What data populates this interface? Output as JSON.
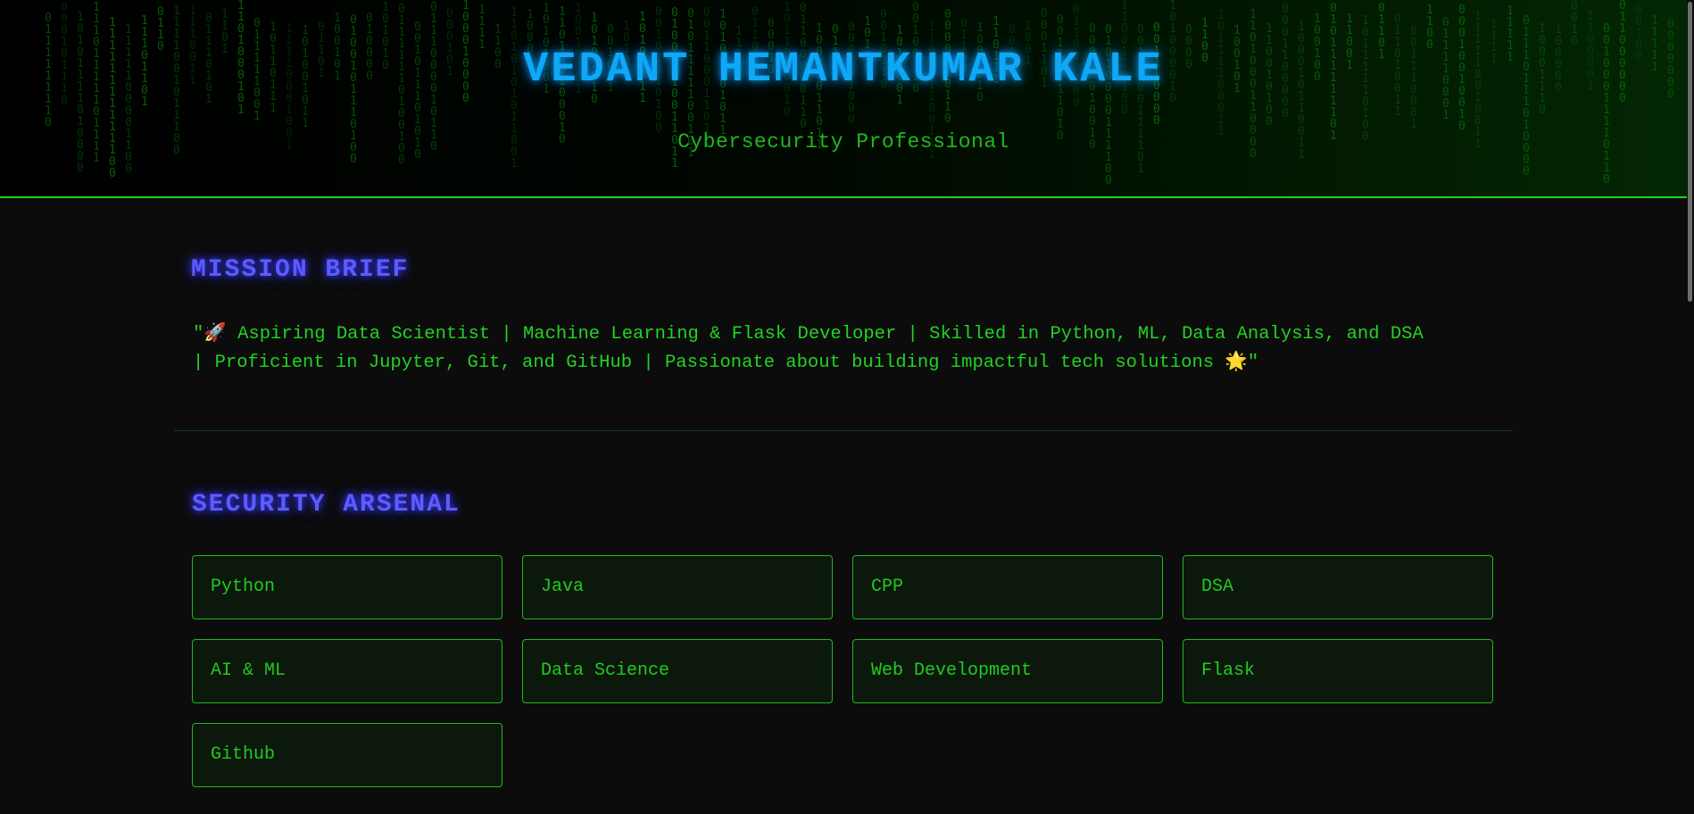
{
  "header": {
    "name": "VEDANT HEMANTKUMAR KALE",
    "role": "Cybersecurity Professional",
    "matrix_digits": "0110100101100111010010101101001011010010110100101101001"
  },
  "mission": {
    "title": "MISSION BRIEF",
    "text": "\"🚀 Aspiring Data Scientist | Machine Learning & Flask Developer | Skilled in Python, ML, Data Analysis, and DSA | Proficient in Jupyter, Git, and GitHub | Passionate about building impactful tech solutions 🌟\""
  },
  "arsenal": {
    "title": "SECURITY ARSENAL",
    "skills": [
      "Python",
      "Java",
      "CPP",
      "DSA",
      "AI & ML",
      "Data Science",
      "Web Development",
      "Flask",
      "Github"
    ]
  },
  "colors": {
    "accent_green": "#1fd41f",
    "title_blue": "#0fa8f7",
    "section_purple": "#5c5cff",
    "background": "#0c0c0c"
  }
}
